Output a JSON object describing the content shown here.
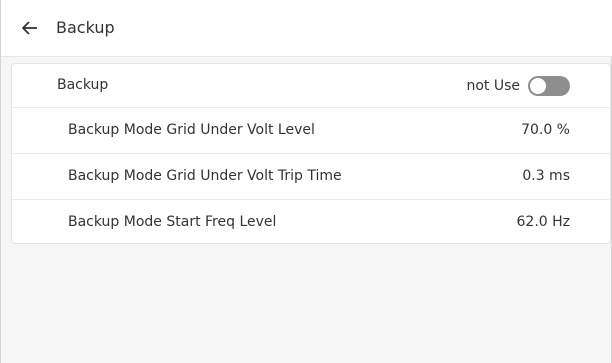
{
  "header": {
    "back_icon": "arrow-left-icon",
    "title": "Backup"
  },
  "settings": {
    "backup": {
      "label": "Backup",
      "status": "not Use",
      "toggle_on": false
    },
    "rows": [
      {
        "label": "Backup Mode Grid Under Volt Level",
        "value": "70.0 %"
      },
      {
        "label": "Backup Mode Grid Under Volt Trip Time",
        "value": "0.3 ms"
      },
      {
        "label": "Backup Mode Start Freq Level",
        "value": "62.0 Hz"
      }
    ]
  },
  "colors": {
    "toggle_off": "#8e8e8e",
    "background": "#f6f6f6"
  }
}
